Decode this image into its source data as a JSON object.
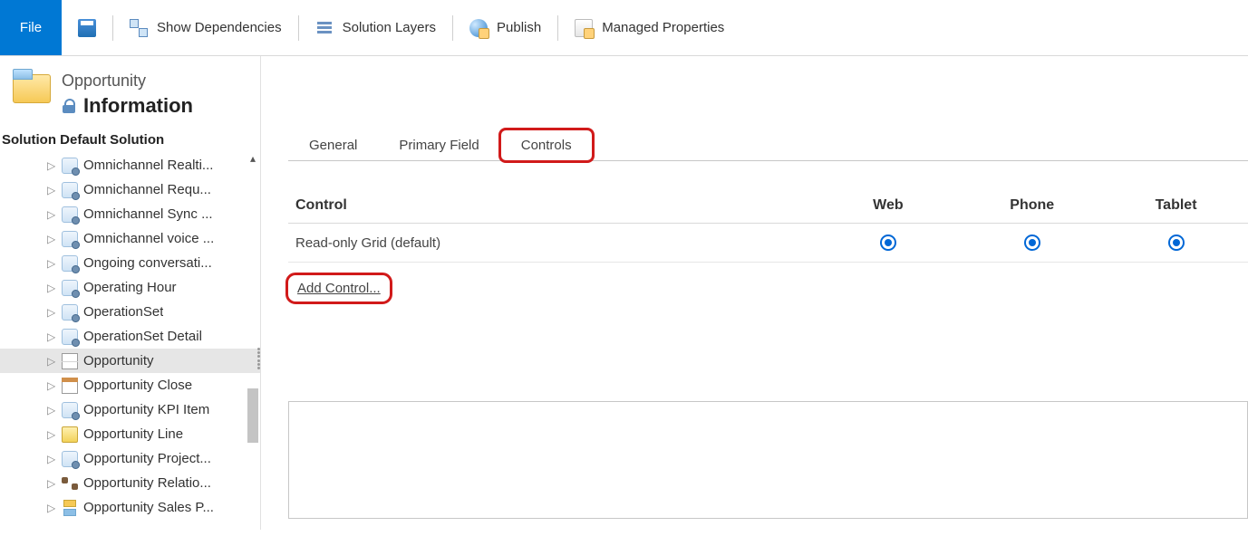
{
  "toolbar": {
    "file": "File",
    "show_dependencies": "Show Dependencies",
    "solution_layers": "Solution Layers",
    "publish": "Publish",
    "managed_properties": "Managed Properties"
  },
  "header": {
    "entity": "Opportunity",
    "subtitle": "Information"
  },
  "solution_label": "Solution Default Solution",
  "tree": [
    {
      "label": "Omnichannel Realti...",
      "icon": "gear"
    },
    {
      "label": "Omnichannel Requ...",
      "icon": "gear"
    },
    {
      "label": "Omnichannel Sync ...",
      "icon": "gear"
    },
    {
      "label": "Omnichannel voice ...",
      "icon": "gear"
    },
    {
      "label": "Ongoing conversati...",
      "icon": "gear"
    },
    {
      "label": "Operating Hour",
      "icon": "gear"
    },
    {
      "label": "OperationSet",
      "icon": "gear"
    },
    {
      "label": "OperationSet Detail",
      "icon": "gear"
    },
    {
      "label": "Opportunity",
      "icon": "table",
      "selected": true
    },
    {
      "label": "Opportunity Close",
      "icon": "calendar"
    },
    {
      "label": "Opportunity KPI Item",
      "icon": "gear"
    },
    {
      "label": "Opportunity Line",
      "icon": "money"
    },
    {
      "label": "Opportunity Project...",
      "icon": "gear"
    },
    {
      "label": "Opportunity Relatio...",
      "icon": "relation"
    },
    {
      "label": "Opportunity Sales P...",
      "icon": "flow"
    }
  ],
  "tabs": [
    {
      "label": "General",
      "active": false,
      "highlight": false
    },
    {
      "label": "Primary Field",
      "active": false,
      "highlight": false
    },
    {
      "label": "Controls",
      "active": true,
      "highlight": true
    }
  ],
  "controls_table": {
    "headers": {
      "control": "Control",
      "web": "Web",
      "phone": "Phone",
      "tablet": "Tablet"
    },
    "rows": [
      {
        "name": "Read-only Grid (default)",
        "web": true,
        "phone": true,
        "tablet": true
      }
    ]
  },
  "add_control_label": "Add Control..."
}
